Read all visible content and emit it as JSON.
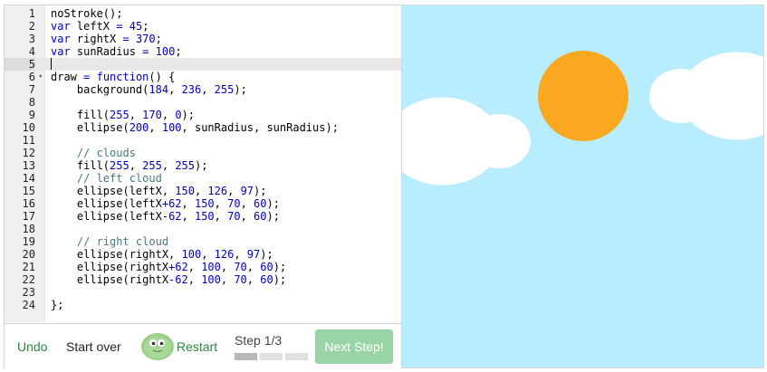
{
  "editor": {
    "lines": [
      {
        "n": "1",
        "t": "noStroke();"
      },
      {
        "n": "2",
        "t": "var leftX = 45;"
      },
      {
        "n": "3",
        "t": "var rightX = 370;"
      },
      {
        "n": "4",
        "t": "var sunRadius = 100;"
      },
      {
        "n": "5",
        "t": ""
      },
      {
        "n": "6",
        "t": "draw = function() {"
      },
      {
        "n": "7",
        "t": "    background(184, 236, 255);"
      },
      {
        "n": "8",
        "t": ""
      },
      {
        "n": "9",
        "t": "    fill(255, 170, 0);"
      },
      {
        "n": "10",
        "t": "    ellipse(200, 100, sunRadius, sunRadius);"
      },
      {
        "n": "11",
        "t": ""
      },
      {
        "n": "12",
        "t": "    // clouds"
      },
      {
        "n": "13",
        "t": "    fill(255, 255, 255);"
      },
      {
        "n": "14",
        "t": "    // left cloud"
      },
      {
        "n": "15",
        "t": "    ellipse(leftX, 150, 126, 97);"
      },
      {
        "n": "16",
        "t": "    ellipse(leftX+62, 150, 70, 60);"
      },
      {
        "n": "17",
        "t": "    ellipse(leftX-62, 150, 70, 60);"
      },
      {
        "n": "18",
        "t": ""
      },
      {
        "n": "19",
        "t": "    // right cloud"
      },
      {
        "n": "20",
        "t": "    ellipse(rightX, 100, 126, 97);"
      },
      {
        "n": "21",
        "t": "    ellipse(rightX+62, 100, 70, 60);"
      },
      {
        "n": "22",
        "t": "    ellipse(rightX-62, 100, 70, 60);"
      },
      {
        "n": "23",
        "t": ""
      },
      {
        "n": "24",
        "t": "};"
      }
    ],
    "active_line": "5",
    "fold_icon_line": "6"
  },
  "toolbar": {
    "undo_label": "Undo",
    "start_over_label": "Start over",
    "restart_label": "Restart",
    "step_label": "Step 1/3",
    "step_current": 1,
    "step_total": 3,
    "next_label": "Next Step!"
  },
  "canvas": {
    "background": "#b8ecff",
    "sun_color": "#faa820",
    "cloud_color": "#ffffff"
  },
  "colors": {
    "accent_green": "#2a8a3a",
    "next_button": "#9ad4a6"
  }
}
